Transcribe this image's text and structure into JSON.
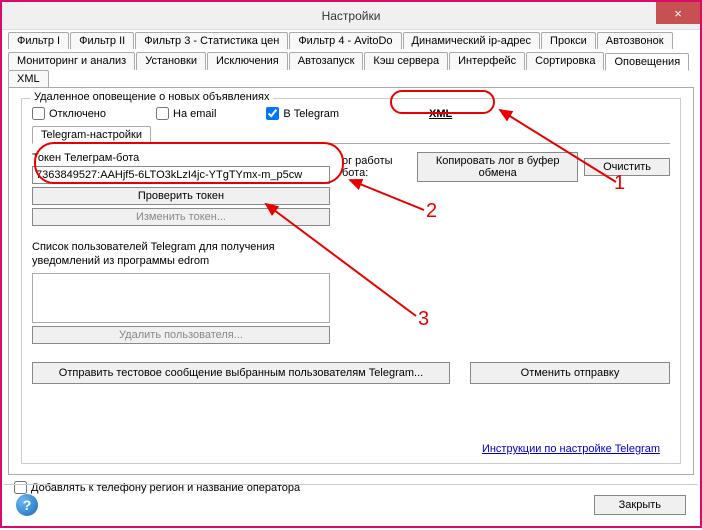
{
  "window": {
    "title": "Настройки",
    "close": "×"
  },
  "tabs_row1": [
    "Фильтр I",
    "Фильтр II",
    "Фильтр 3 - Статистика цен",
    "Фильтр 4 - AvitoDo",
    "Динамический ip-адрес",
    "Прокси",
    "Автозвонок"
  ],
  "tabs_row2": [
    "Мониторинг и анализ",
    "Установки",
    "Исключения",
    "Автозапуск",
    "Кэш сервера",
    "Интерфейс",
    "Сортировка",
    "Оповещения",
    "XML"
  ],
  "active_tab": "Оповещения",
  "group": {
    "title": "Удаленное оповещение о новых объявлениях",
    "chk_disabled": "Отключено",
    "chk_email": "На email",
    "chk_telegram": "В Telegram",
    "link_xml": "XML",
    "subtab": "Telegram-настройки",
    "token_label": "Токен Телеграм-бота",
    "token_value": "7363849527:AAHjf5-6LTO3kLzI4jc-YTgTYmx-m_p5cw",
    "btn_check": "Проверить токен",
    "btn_change": "Изменить токен...",
    "userlist_label": "Список пользователей Telegram для получения уведомлений из программы edrom",
    "btn_deluser": "Удалить пользователя...",
    "log_label": "ог работы бота:",
    "btn_copylog": "Копировать лог в буфер обмена",
    "btn_clear": "Очистить",
    "btn_sendtest": "Отправить тестовое сообщение выбранным пользователям Telegram...",
    "btn_cancel": "Отменить отправку",
    "instr_link": "Инструкции по настройке Telegram"
  },
  "footer_check": "Добавлять к телефону регион и название оператора",
  "help": "?",
  "btn_close": "Закрыть",
  "anno": {
    "n1": "1",
    "n2": "2",
    "n3": "3"
  }
}
